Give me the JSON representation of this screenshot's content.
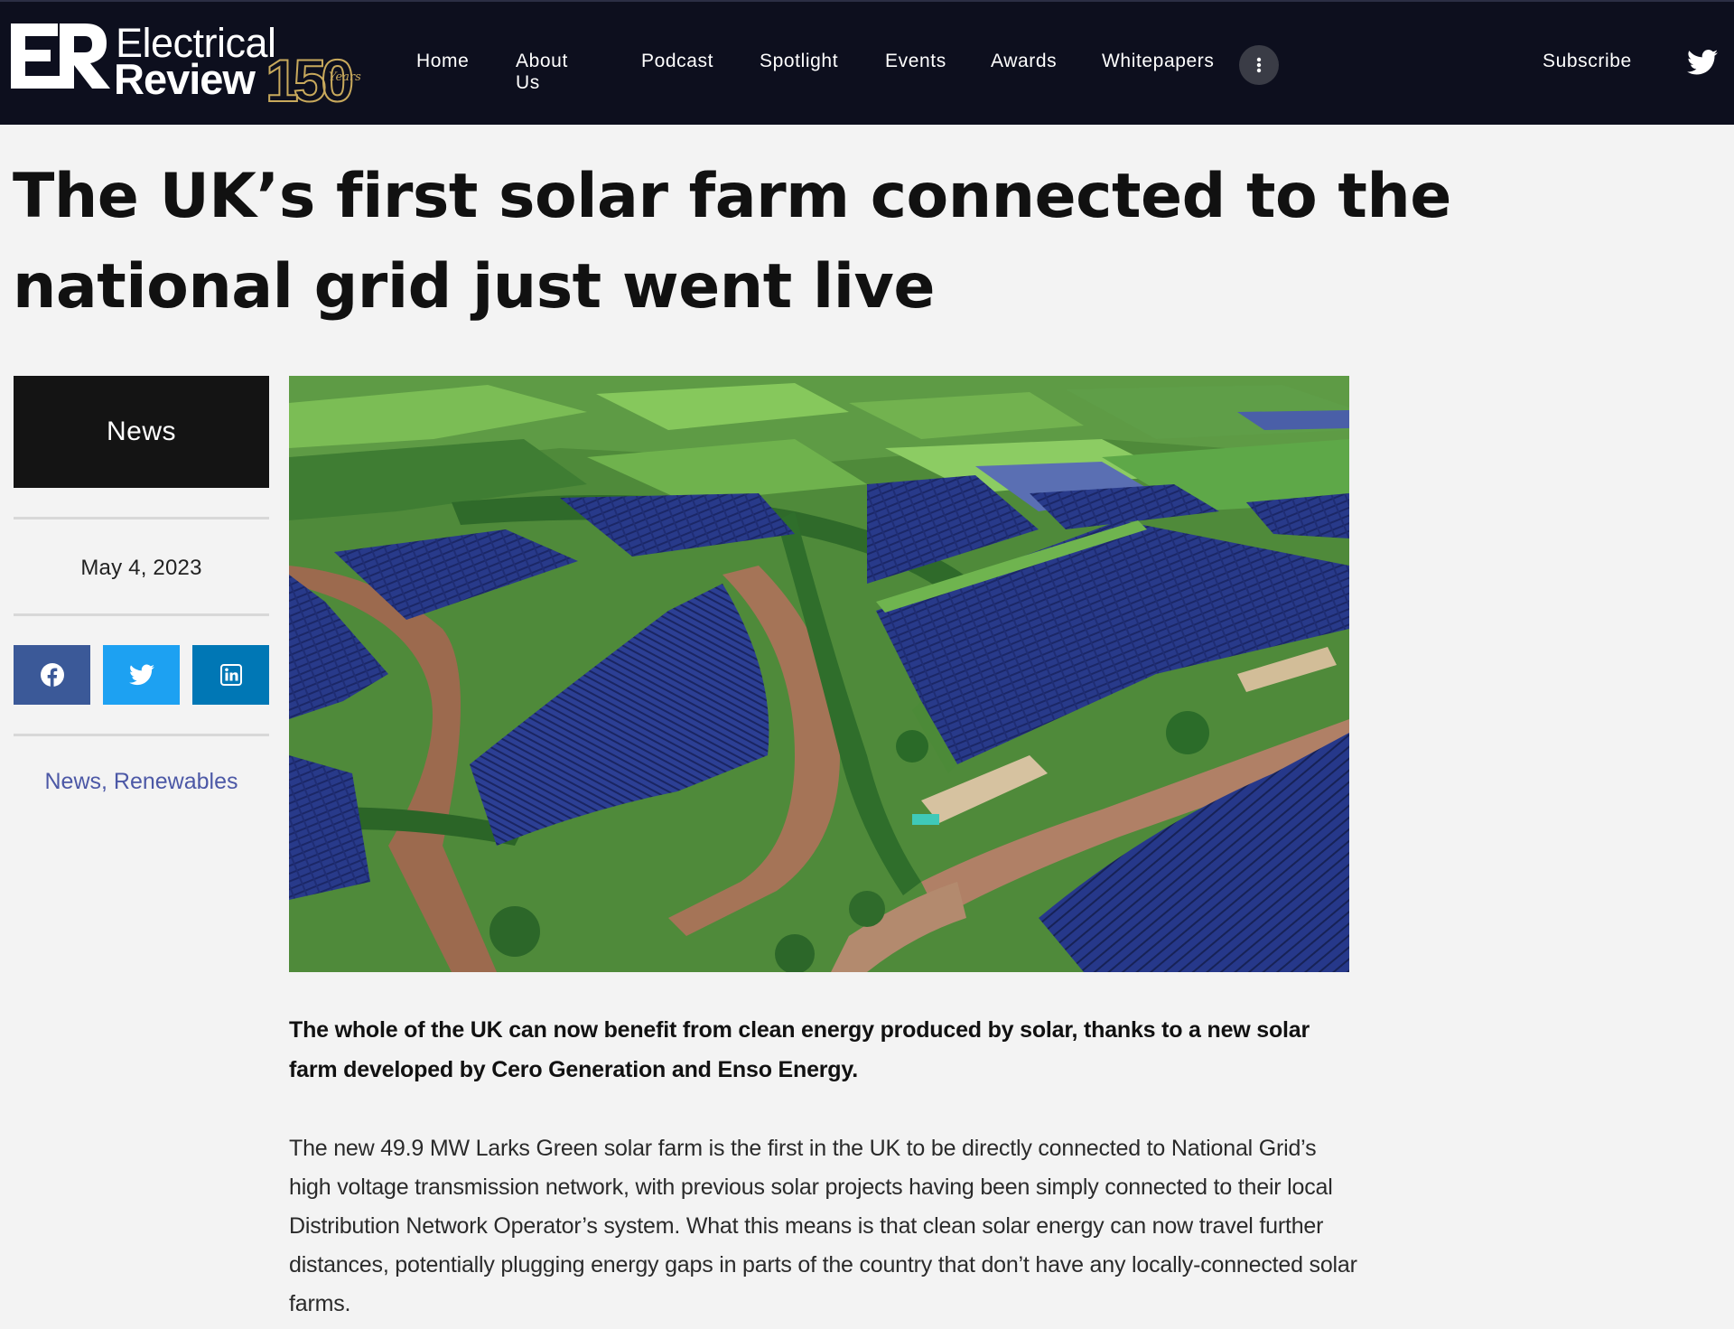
{
  "nav": {
    "logo": {
      "line1": "Electrical",
      "line2": "Review",
      "anniversary": "150",
      "anniversary_word": "Years"
    },
    "items": [
      {
        "label": "Home"
      },
      {
        "label": "About Us"
      },
      {
        "label": "Podcast"
      },
      {
        "label": "Spotlight"
      },
      {
        "label": "Events"
      },
      {
        "label": "Awards"
      },
      {
        "label": "Whitepapers"
      }
    ],
    "more_icon": "vertical-dots-icon",
    "subscribe_label": "Subscribe",
    "social_icon": "twitter-icon"
  },
  "article": {
    "title": "The UK’s first solar farm connected to the national grid just went live",
    "category": "News",
    "date": "May 4, 2023",
    "share_buttons": [
      {
        "icon": "facebook-icon",
        "color": "#3b5998"
      },
      {
        "icon": "twitter-icon",
        "color": "#1da1f2"
      },
      {
        "icon": "linkedin-icon",
        "color": "#0077b5"
      }
    ],
    "tags": [
      "News",
      "Renewables"
    ],
    "tag_separator": ", ",
    "hero_image": "aerial-solar-farm-photo",
    "lead": "The whole of the UK can now benefit from clean energy produced by solar, thanks to a new solar farm developed by Cero Generation and Enso Energy.",
    "body": "The new 49.9 MW Larks Green solar farm is the first in the UK to be directly connected to National Grid’s high voltage transmission network, with previous solar projects having been simply connected to their local Distribution Network Operator’s system. What this means is that clean solar energy can now travel further distances, potentially plugging energy gaps in parts of the country that don’t have any locally-connected solar farms."
  },
  "colors": {
    "nav_bg": "#0d0f1e",
    "page_bg": "#f3f3f3",
    "category_bg": "#141414",
    "tag_link": "#4c58a6",
    "logo_gold": "#c8a95c"
  }
}
